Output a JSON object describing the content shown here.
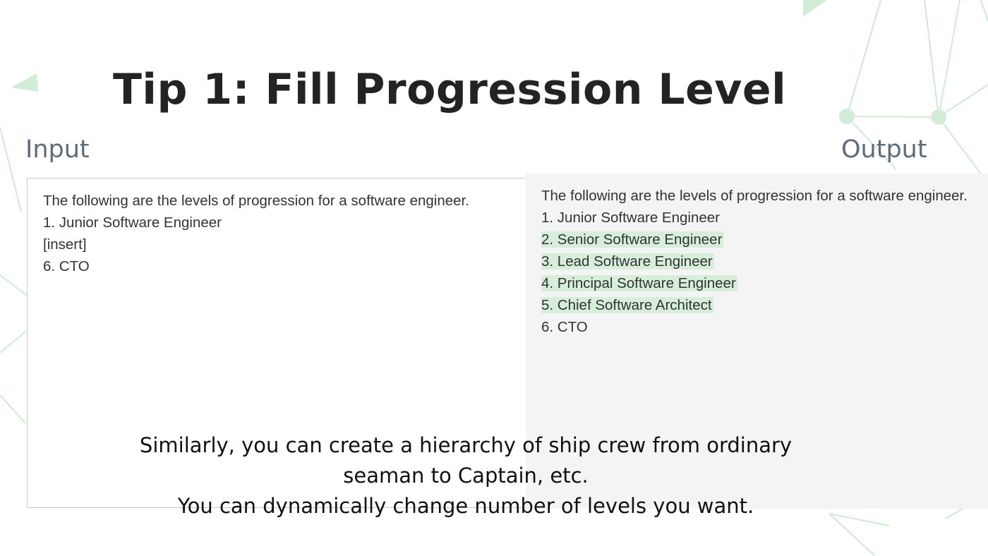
{
  "slide": {
    "title": "Tip 1: Fill Progression Level"
  },
  "input": {
    "heading": "Input",
    "lines": [
      "The following are the levels of progression for a software engineer.",
      "1. Junior Software Engineer",
      "[insert]",
      "6. CTO"
    ]
  },
  "output": {
    "heading": "Output",
    "lines": [
      "The following are the levels of progression for a software engineer.",
      "1. Junior Software Engineer",
      "2. Senior Software Engineer",
      "3. Lead Software Engineer",
      "4. Principal Software Engineer",
      "5. Chief Software Architect",
      "6. CTO"
    ],
    "highlight_color": "#d7eedb"
  },
  "caption": {
    "lines": [
      "Similarly, you can create a hierarchy of ship crew from ordinary",
      "seaman to Captain, etc.",
      "You can dynamically change number of levels you want."
    ]
  },
  "colors": {
    "title": "#232323",
    "heading": "#5d6b7d",
    "output_bg": "#f4f4f4",
    "decor": "#a6d8b0"
  }
}
